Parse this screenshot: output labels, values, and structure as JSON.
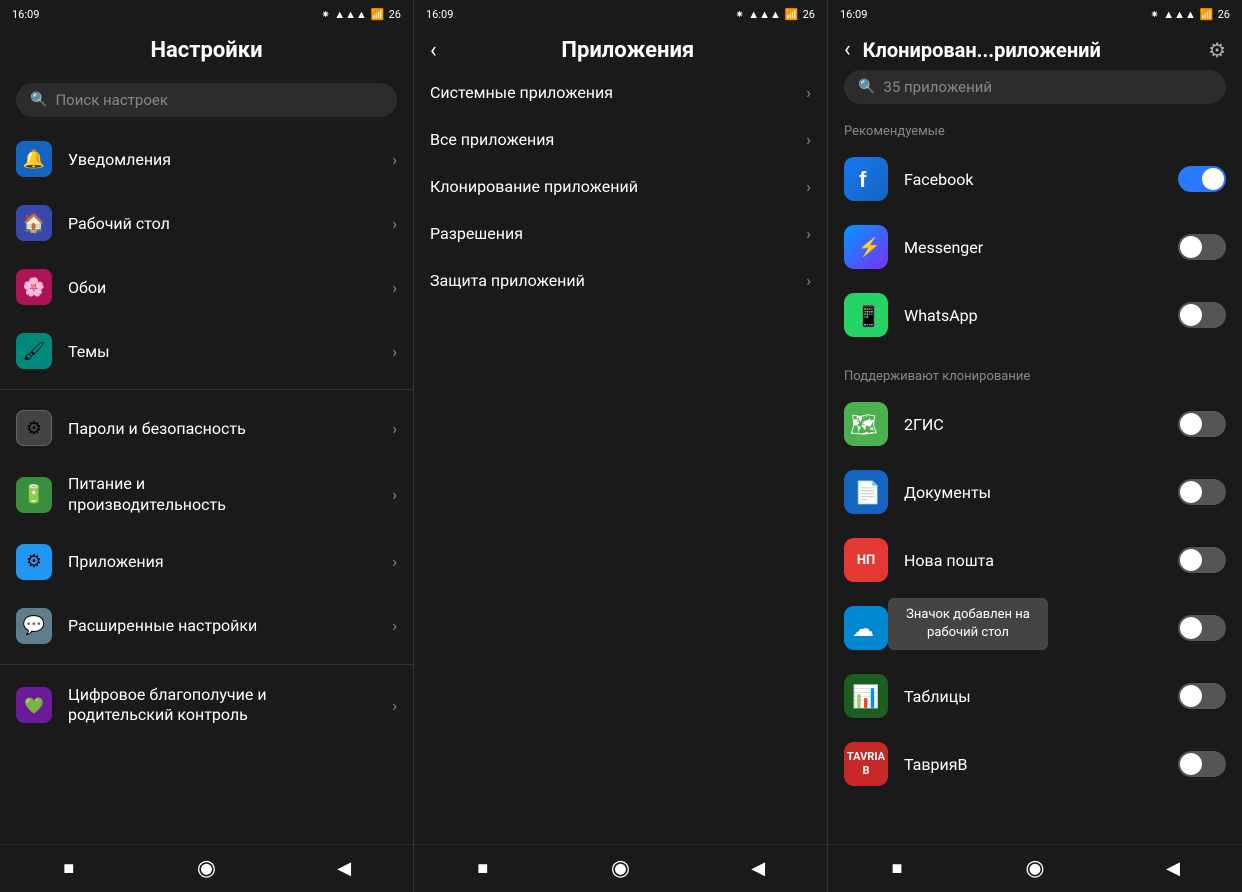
{
  "panel1": {
    "statusBar": {
      "time": "16:09",
      "rightIcons": "🔋📶"
    },
    "title": "Настройки",
    "searchPlaceholder": "Поиск настроек",
    "items": [
      {
        "id": "notifications",
        "label": "Уведомления",
        "iconBg": "#1565c0",
        "iconChar": "🔔",
        "hasChevron": true
      },
      {
        "id": "desktop",
        "label": "Рабочий стол",
        "iconBg": "#3949ab",
        "iconChar": "🏠",
        "hasChevron": true
      },
      {
        "id": "wallpaper",
        "label": "Обои",
        "iconBg": "#c2185b",
        "iconChar": "🌸",
        "hasChevron": true
      },
      {
        "id": "themes",
        "label": "Темы",
        "iconBg": "#00897b",
        "iconChar": "🖌",
        "hasChevron": true
      }
    ],
    "items2": [
      {
        "id": "passwords",
        "label": "Пароли и безопасность",
        "iconBg": "#555",
        "iconChar": "⚙",
        "hasChevron": true
      },
      {
        "id": "power",
        "label": "Питание и производительность",
        "iconBg": "#388e3c",
        "iconChar": "🔋",
        "hasChevron": true
      },
      {
        "id": "apps",
        "label": "Приложения",
        "iconBg": "#1976d2",
        "iconChar": "⚙",
        "hasChevron": true
      },
      {
        "id": "advanced",
        "label": "Расширенные настройки",
        "iconBg": "#607d8b",
        "iconChar": "💬",
        "hasChevron": true
      }
    ],
    "items3": [
      {
        "id": "digital",
        "label": "Цифровое благополучие и родительский контроль",
        "iconBg": "#6a1b9a",
        "iconChar": "💚",
        "hasChevron": true
      }
    ],
    "navBar": {
      "square": "■",
      "circle": "●",
      "triangle": "◀"
    }
  },
  "panel2": {
    "statusBar": {
      "time": "16:09"
    },
    "backLabel": "<",
    "title": "Приложения",
    "items": [
      {
        "id": "system",
        "label": "Системные приложения",
        "hasChevron": true
      },
      {
        "id": "all",
        "label": "Все приложения",
        "hasChevron": true
      },
      {
        "id": "clone",
        "label": "Клонирование приложений",
        "hasChevron": true
      },
      {
        "id": "permissions",
        "label": "Разрешения",
        "hasChevron": true
      },
      {
        "id": "protection",
        "label": "Защита приложений",
        "hasChevron": true
      }
    ],
    "navBar": {
      "square": "■",
      "circle": "●",
      "triangle": "◀"
    }
  },
  "panel3": {
    "statusBar": {
      "time": "16:09"
    },
    "backLabel": "<",
    "title": "Клонирован...риложений",
    "searchPlaceholder": "35 приложений",
    "sectionRecommended": "Рекомендуемые",
    "sectionSupported": "Поддерживают клонирование",
    "apps": [
      {
        "id": "facebook",
        "name": "Facebook",
        "toggleOn": true,
        "iconType": "facebook"
      },
      {
        "id": "messenger",
        "name": "Messenger",
        "toggleOn": false,
        "iconType": "messenger"
      },
      {
        "id": "whatsapp",
        "name": "WhatsApp",
        "toggleOn": false,
        "iconType": "whatsapp"
      }
    ],
    "supportedApps": [
      {
        "id": "2gis",
        "name": "2ГИС",
        "toggleOn": false,
        "iconType": "gis"
      },
      {
        "id": "docs",
        "name": "Документы",
        "toggleOn": false,
        "iconType": "docs"
      },
      {
        "id": "novaposhta",
        "name": "Нова пошта",
        "toggleOn": false,
        "iconType": "novaposhta",
        "tooltip": "Значок добавлен на рабочий стол"
      },
      {
        "id": "cloudy",
        "name": "",
        "toggleOn": false,
        "iconType": "cloudy",
        "hasTooltip": true
      },
      {
        "id": "sheets",
        "name": "Таблицы",
        "toggleOn": false,
        "iconType": "sheets"
      },
      {
        "id": "tavria",
        "name": "ТаврияВ",
        "toggleOn": false,
        "iconType": "tavria"
      }
    ],
    "tooltipText": "Значок добавлен на рабочий стол",
    "navBar": {
      "square": "■",
      "circle": "●",
      "triangle": "◀"
    }
  }
}
